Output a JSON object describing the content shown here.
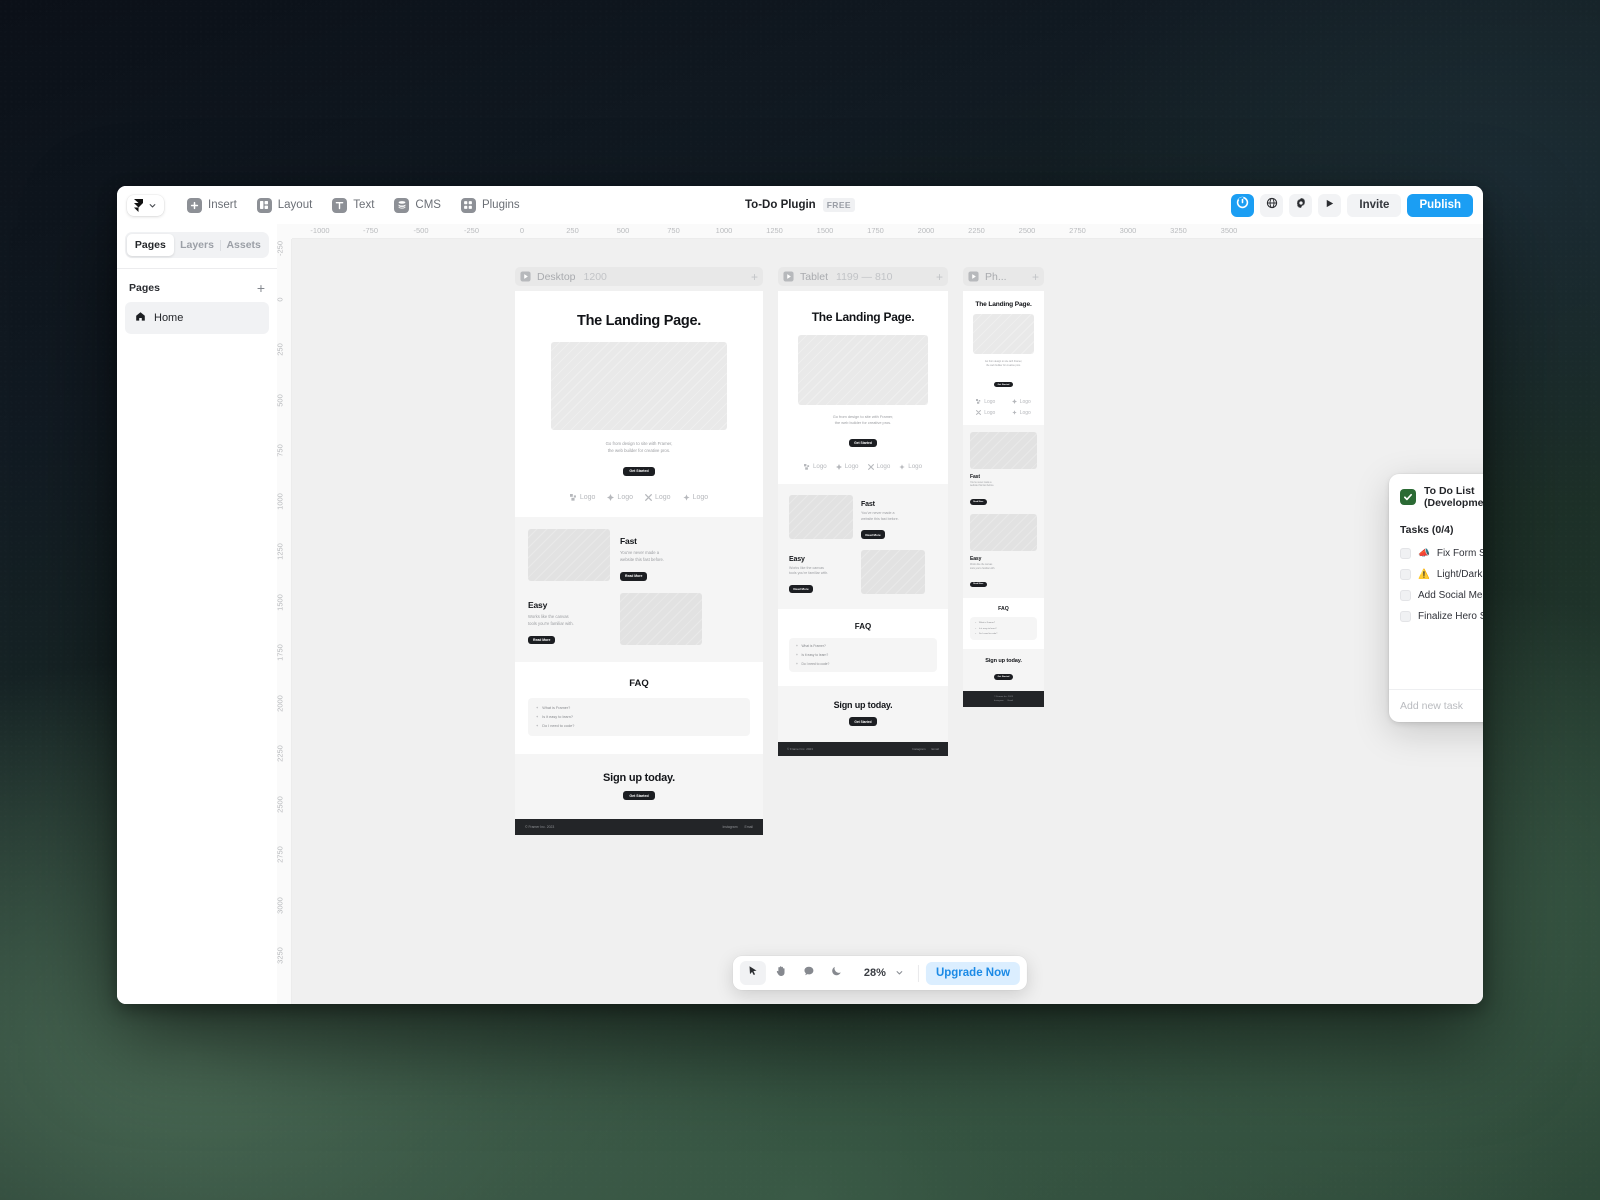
{
  "app": {
    "title": "To-Do Plugin",
    "badge": "FREE",
    "logo_icon": "framer-logo-icon",
    "chevron_icon": "chevron-down-icon",
    "accent": "#1b9ef3"
  },
  "menu": [
    {
      "label": "Insert",
      "icon": "plus-square-icon"
    },
    {
      "label": "Layout",
      "icon": "layout-columns-icon"
    },
    {
      "label": "Text",
      "icon": "text-t-icon"
    },
    {
      "label": "CMS",
      "icon": "database-stack-icon"
    },
    {
      "label": "Plugins",
      "icon": "grid-four-icon"
    }
  ],
  "topbar_right": {
    "plugin_icon": "power-plugin-icon",
    "globe_icon": "globe-icon",
    "settings_icon": "gear-icon",
    "preview_icon": "play-icon",
    "invite_label": "Invite",
    "publish_label": "Publish"
  },
  "left_panel": {
    "tabs": [
      {
        "label": "Pages",
        "selected": true
      },
      {
        "label": "Layers",
        "selected": false
      },
      {
        "label": "Assets",
        "selected": false
      }
    ],
    "section_title": "Pages",
    "add_icon": "plus-icon",
    "pages": [
      {
        "label": "Home",
        "icon": "home-icon",
        "selected": true
      }
    ]
  },
  "rulers": {
    "horizontal": [
      "-1000",
      "-750",
      "-500",
      "-250",
      "0",
      "250",
      "500",
      "750",
      "1000",
      "1250",
      "1500",
      "1750",
      "2000",
      "2250",
      "2500",
      "2750",
      "3000",
      "3250",
      "3500"
    ],
    "vertical": [
      "-250",
      "0",
      "250",
      "500",
      "750",
      "1000",
      "1250",
      "1500",
      "1750",
      "2000",
      "2250",
      "2500",
      "2750",
      "3000",
      "3250"
    ]
  },
  "frames": [
    {
      "name": "Desktop",
      "dimensions": "1200",
      "play_icon": "play-frame-icon",
      "add_icon": "plus-icon",
      "highlight": true
    },
    {
      "name": "Tablet",
      "dimensions": "1199 — 810",
      "play_icon": "play-frame-icon",
      "add_icon": "plus-icon",
      "highlight": true
    },
    {
      "name": "Ph...",
      "dimensions": "",
      "play_icon": "play-frame-icon",
      "add_icon": "plus-icon",
      "highlight": true
    }
  ],
  "landing_page": {
    "hero_title": "The Landing Page.",
    "hero_sub_line1": "Go from design to site with Framer,",
    "hero_sub_line2": "the web builder for creative pros.",
    "hero_cta": "Get Started",
    "logos": [
      {
        "label": "Logo",
        "icon": "blocks-logo-icon"
      },
      {
        "label": "Logo",
        "icon": "diamond-logo-icon"
      },
      {
        "label": "Logo",
        "icon": "x-logo-icon"
      },
      {
        "label": "Logo",
        "icon": "sparkle-logo-icon"
      }
    ],
    "features": [
      {
        "title": "Fast",
        "body_line1": "You've never made a",
        "body_line2": "website this fast before.",
        "cta": "Read More"
      },
      {
        "title": "Easy",
        "body_line1": "Works like the canvas",
        "body_line2": "tools you're familiar with.",
        "cta": "Read More"
      }
    ],
    "faq_title": "FAQ",
    "faq_items": [
      "What is Framer?",
      "Is it easy to learn?",
      "Do I need to code?"
    ],
    "signup_title": "Sign up today.",
    "signup_cta": "Get Started",
    "footer_copyright": "© Framer Inc. 2023",
    "footer_links": [
      "Instagram",
      "Email"
    ]
  },
  "todo_plugin": {
    "title": "To Do List (Development)",
    "check_icon": "checkmark-icon",
    "close_icon": "close-icon",
    "tasks_header": "Tasks (0/4)",
    "collapse_icon": "triangle-up-icon",
    "tasks": [
      {
        "emoji": "📣",
        "label": "Fix Form Submission",
        "checked": false
      },
      {
        "emoji": "⚠️",
        "label": "Light/Dark Mode Toggle",
        "checked": false
      },
      {
        "emoji": "",
        "label": "Add Social Media Icons",
        "checked": false
      },
      {
        "emoji": "",
        "label": "Finalize Hero Section Text",
        "checked": false
      }
    ],
    "new_task_placeholder": "Add new task",
    "new_task_value": "",
    "add_icon": "plus-icon"
  },
  "bottom_toolbar": {
    "tools": [
      {
        "name": "cursor-tool",
        "icon": "cursor-arrow-icon",
        "active": true
      },
      {
        "name": "hand-tool",
        "icon": "hand-icon",
        "active": false
      },
      {
        "name": "comment-tool",
        "icon": "comment-bubble-icon",
        "active": false
      },
      {
        "name": "theme-tool",
        "icon": "moon-icon",
        "active": false
      }
    ],
    "zoom_level": "28%",
    "zoom_chevron_icon": "chevron-down-icon",
    "upgrade_label": "Upgrade Now"
  }
}
